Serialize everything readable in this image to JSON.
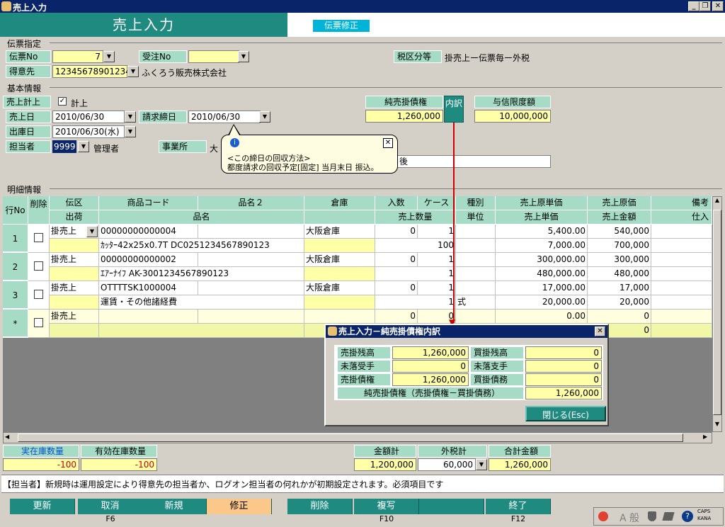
{
  "window": {
    "title": "売上入力",
    "min": "_",
    "max": "❐",
    "close": "✕"
  },
  "header": {
    "title": "売上入力",
    "mode": "伝票修正"
  },
  "slip": {
    "section": "伝票指定",
    "no_label": "伝票No",
    "no_value": "7",
    "order_label": "受注No",
    "order_value": "",
    "customer_label": "得意先",
    "customer_code": "12345678901234",
    "customer_name": "ふくろう販売株式会社",
    "tax_label": "税区分等",
    "tax_value": "掛売上ー伝票毎ー外税"
  },
  "basic": {
    "section": "基本情報",
    "post_label": "売上計上",
    "post_check": "計上",
    "sales_date_label": "売上日",
    "sales_date": "2010/06/30",
    "bill_close_label": "請求締日",
    "bill_close": "2010/06/30",
    "ship_date_label": "出庫日",
    "ship_date": "2010/06/30(水)",
    "staff_label": "担当者",
    "staff_code": "9999",
    "staff_name": "管理者",
    "office_label": "事業所",
    "office_value": "大",
    "net_label": "純売掛債権",
    "net_value": "1,260,000",
    "detail_btn": "内訳",
    "credit_label": "与信限度額",
    "credit_value": "10,000,000",
    "extra_value": "後"
  },
  "tooltip": {
    "line1": "<この締日の回収方法>",
    "line2": "都度請求の回収予定[固定] 当月末日 振込。"
  },
  "details": {
    "section": "明細情報",
    "headers": {
      "row_no": "行No",
      "del": "削除",
      "voucher": "伝区",
      "ship": "出荷",
      "item_code": "商品コード",
      "item_name2": "品名２",
      "item_name": "品名",
      "warehouse": "倉庫",
      "qty_in": "入数",
      "case": "ケース",
      "kind": "種別",
      "cost_unit": "売上原単価",
      "cost": "売上原価",
      "sales_qty": "売上数量",
      "unit": "単位",
      "unit_price": "売上単価",
      "amount": "売上金額",
      "note": "備考",
      "purchase": "仕入"
    },
    "rows": [
      {
        "no": "1",
        "voucher": "掛売上",
        "code": "00000000000004",
        "name": "ｶｯﾀｰ42x25x0.7T DC0251234567890123",
        "warehouse": "大阪倉庫",
        "qty_in": "0",
        "case": "1",
        "sales_qty": "100",
        "unit": "",
        "cost_unit": "5,400.00",
        "cost": "540,000",
        "unit_price": "7,000.00",
        "amount": "700,000"
      },
      {
        "no": "2",
        "voucher": "掛売上",
        "code": "00000000000002",
        "name": "ｴｱｰﾅｲﾌ AK-3001234567890123",
        "warehouse": "大阪倉庫",
        "qty_in": "0",
        "case": "1",
        "sales_qty": "1",
        "unit": "",
        "cost_unit": "300,000.00",
        "cost": "300,000",
        "unit_price": "480,000.00",
        "amount": "480,000"
      },
      {
        "no": "3",
        "voucher": "掛売上",
        "code": "OTTTTSK1000004",
        "name": "運賃・その他諸経費",
        "warehouse": "大阪倉庫",
        "qty_in": "0",
        "case": "1",
        "sales_qty": "1",
        "unit": "式",
        "cost_unit": "17,000.00",
        "cost": "17,000",
        "unit_price": "20,000.00",
        "amount": "20,000"
      },
      {
        "no": "*",
        "voucher": "掛売上",
        "code": "",
        "name": "",
        "warehouse": "",
        "qty_in": "0",
        "case": "0",
        "sales_qty": "",
        "unit": "",
        "cost_unit": "0.00",
        "cost": "0",
        "unit_price": "",
        "amount": "0"
      }
    ]
  },
  "dialog": {
    "title": "売上入力－純売掛債権内訳",
    "ar_label": "売掛残高",
    "ar": "1,260,000",
    "ap_label": "買掛残高",
    "ap": "0",
    "nr_label": "未落受手",
    "nr": "0",
    "np_label": "未落支手",
    "np": "0",
    "rec_label": "売掛債権",
    "rec": "1,260,000",
    "pay_label": "買掛債務",
    "pay": "0",
    "net_label": "純売掛債権（売掛債権－買掛債務）",
    "net": "1,260,000",
    "close_btn": "閉じる(Esc)"
  },
  "stock": {
    "actual_label": "実在庫数量",
    "actual": "-100",
    "valid_label": "有効在庫数量",
    "valid": "-100"
  },
  "totals": {
    "amount_label": "金額計",
    "amount": "1,200,000",
    "tax_label": "外税計",
    "tax": "60,000",
    "total_label": "合計金額",
    "total": "1,260,000"
  },
  "help": "【担当者】新規時は運用設定により得意先の担当者か、ログオン担当者の何れかが初期設定されます。必須項目です",
  "fkeys": [
    {
      "label": "更新",
      "key": ""
    },
    {
      "label": "取消",
      "key": "F6"
    },
    {
      "label": "新規",
      "key": ""
    },
    {
      "label": "修正",
      "key": ""
    },
    {
      "label": "削除",
      "key": ""
    },
    {
      "label": "複写",
      "key": "F10"
    },
    {
      "label": "",
      "key": ""
    },
    {
      "label": "終了",
      "key": "F12"
    }
  ],
  "tray": {
    "ime": "A 般",
    "caps": "CAPS",
    "kana": "KANA"
  }
}
